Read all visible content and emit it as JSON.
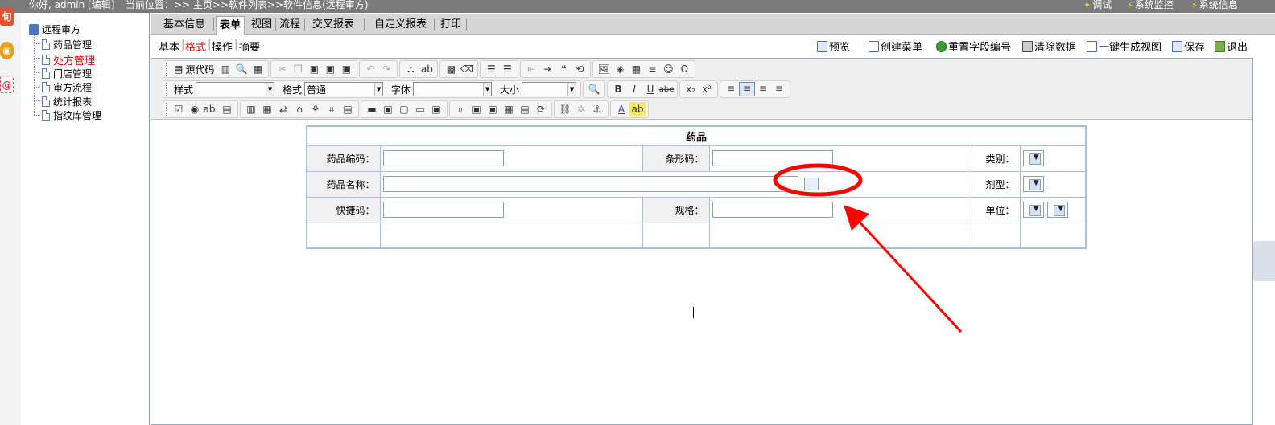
{
  "topbar": {
    "greeting": "你好, admin [编辑]",
    "breadcrumb": "当前位置：>> 主页>>软件列表>>软件信息(远程审方)",
    "right_items": [
      "调试",
      "系统监控",
      "系统信息"
    ]
  },
  "tree": {
    "root": "远程审方",
    "items": [
      "药品管理",
      "处方管理",
      "门店管理",
      "审方流程",
      "统计报表",
      "指纹库管理"
    ],
    "active_index": 1
  },
  "tabs": {
    "items": [
      "基本信息",
      "表单",
      "视图",
      "流程",
      "交叉报表",
      "自定义报表",
      "打印"
    ],
    "active_index": 1
  },
  "subtabs": {
    "items": [
      "基本",
      "格式",
      "操作",
      "摘要"
    ],
    "active_index": 1
  },
  "actions": [
    "预览",
    "创建菜单",
    "重置字段编号",
    "清除数据",
    "一键生成视图",
    "保存",
    "退出"
  ],
  "editor_toolbar": {
    "source_label": "源代码",
    "style_label": "样式",
    "format_label": "格式",
    "format_value": "普通",
    "font_label": "字体",
    "size_label": "大小"
  },
  "form": {
    "title": "药品",
    "labels": {
      "code": "药品编码：",
      "barcode": "条形码：",
      "category": "类别：",
      "name": "药品名称：",
      "dosage": "剂型：",
      "quick_code": "快捷码：",
      "spec": "规格：",
      "unit": "单位："
    }
  },
  "colors": {
    "topbar": "#7a7a7a",
    "active_red": "#e00000",
    "annotation_red": "#ff0000",
    "table_border": "#a8c0dc"
  }
}
